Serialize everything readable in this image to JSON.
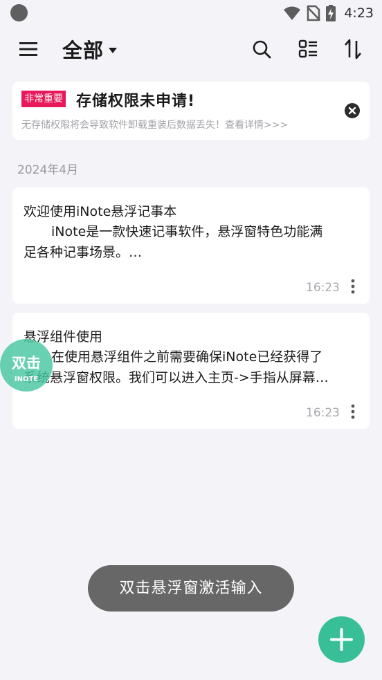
{
  "status_bar": {
    "time": "4:23"
  },
  "top_bar": {
    "title": "全部",
    "icons": [
      "menu-icon",
      "caret-down-icon",
      "search-icon",
      "list-view-icon",
      "sort-icon"
    ]
  },
  "warning_card": {
    "badge": "非常重要",
    "title": "存储权限未申请!",
    "subtitle": "无存储权限将会导致软件卸载重装后数据丢失！查看详情>>>"
  },
  "section": {
    "date_label": "2024年4月"
  },
  "notes": [
    {
      "title": "欢迎使用iNote悬浮记事本",
      "body_line1": "iNote是一款快速记事软件，悬浮窗特色功能满",
      "body_line2": "足各种记事场景。…",
      "time": "16:23"
    },
    {
      "title": "悬浮组件使用",
      "body_line1": "在使用悬浮组件之前需要确保iNote已经获得了",
      "body_line2": "系统悬浮窗权限。我们可以进入主页->手指从屏幕…",
      "time": "16:23"
    }
  ],
  "floating_bubble": {
    "label": "双击",
    "sublabel": "INOTE"
  },
  "toast": {
    "text": "双击悬浮窗激活输入"
  },
  "colors": {
    "background": "#f3f3f8",
    "badge": "#e8195a",
    "accent": "#38bf97",
    "bubble": "#48c7a0",
    "toast": "#676767"
  }
}
